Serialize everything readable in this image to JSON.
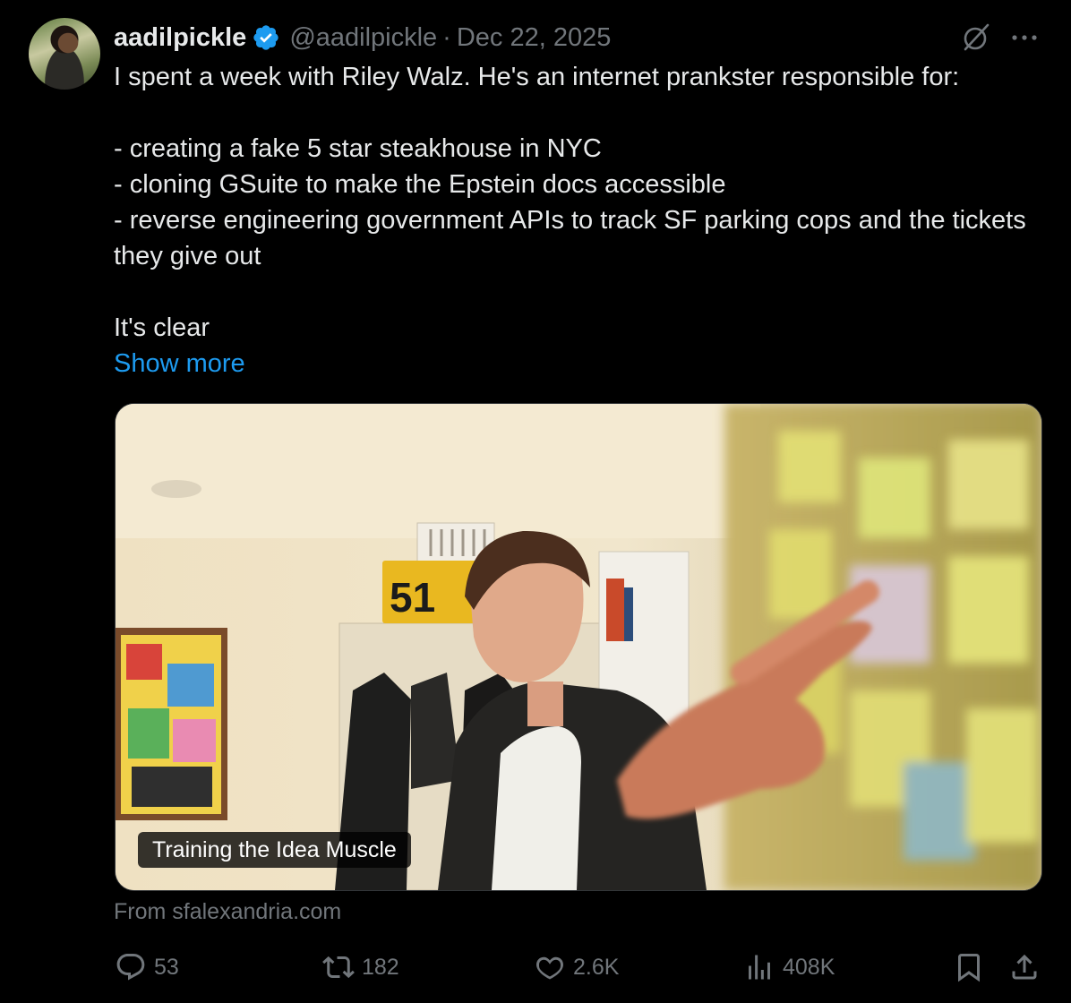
{
  "tweet": {
    "display_name": "aadilpickle",
    "handle": "@aadilpickle",
    "separator": "·",
    "date": "Dec 22, 2025",
    "lines": [
      "I spent a week with Riley Walz. He's an internet prankster responsible for:",
      "- creating a fake 5 star steakhouse in NYC",
      "- cloning GSuite to make the Epstein docs accessible",
      "- reverse engineering government APIs to track SF parking cops and the tickets they give out",
      "It's clear"
    ],
    "show_more": "Show more",
    "media": {
      "caption": "Training the Idea Muscle",
      "source": "From sfalexandria.com",
      "sign_number": "51"
    }
  },
  "actions": {
    "replies": "53",
    "reposts": "182",
    "likes": "2.6K",
    "views": "408K"
  },
  "icons": {
    "verified": "verified-badge-icon",
    "grok": "grok-icon",
    "more": "more-icon",
    "reply": "reply-icon",
    "repost": "repost-icon",
    "like": "heart-icon",
    "views": "views-icon",
    "bookmark": "bookmark-icon",
    "share": "share-icon"
  },
  "colors": {
    "background": "#000000",
    "text": "#e7e9ea",
    "muted": "#71767b",
    "accent": "#1d9bf0"
  }
}
